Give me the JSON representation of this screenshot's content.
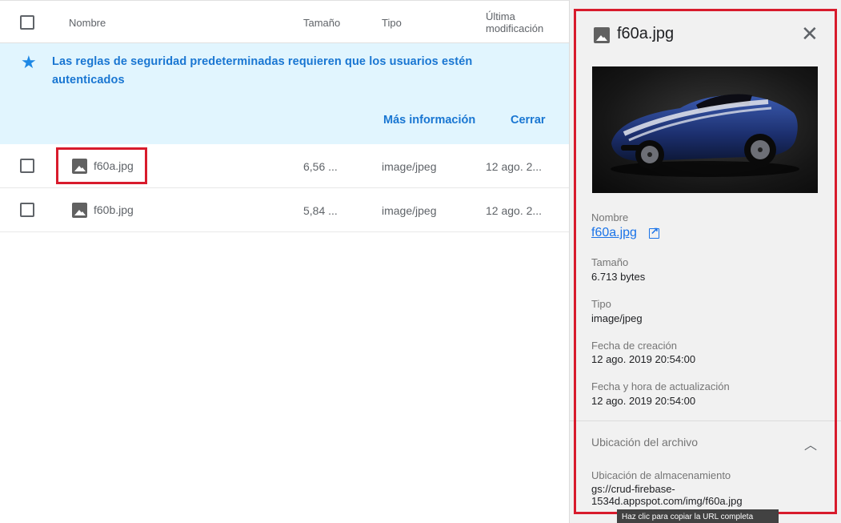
{
  "list": {
    "headers": {
      "name": "Nombre",
      "size": "Tamaño",
      "type": "Tipo",
      "modified_line1": "Última",
      "modified_line2": "modificación"
    },
    "banner": {
      "message": "Las reglas de seguridad predeterminadas requieren que los usuarios estén autenticados",
      "more_info": "Más información",
      "close": "Cerrar",
      "icon": "star-icon",
      "accent": "#1976d2",
      "background": "#e1f5fe"
    },
    "rows": [
      {
        "name": "f60a.jpg",
        "size": "6,56 ...",
        "type": "image/jpeg",
        "modified": "12 ago. 2...",
        "icon": "image-icon"
      },
      {
        "name": "f60b.jpg",
        "size": "5,84 ...",
        "type": "image/jpeg",
        "modified": "12 ago. 2...",
        "icon": "image-icon"
      }
    ],
    "highlight_color": "#d81b2c"
  },
  "detail": {
    "title": "f60a.jpg",
    "title_icon": "image-icon",
    "close_icon": "close-icon",
    "name_label": "Nombre",
    "name_value": "f60a.jpg",
    "size_label": "Tamaño",
    "size_value": "6.713 bytes",
    "type_label": "Tipo",
    "type_value": "image/jpeg",
    "created_label": "Fecha de creación",
    "created_value": "12 ago. 2019 20:54:00",
    "updated_label": "Fecha y hora de actualización",
    "updated_value": "12 ago. 2019 20:54:00",
    "location_section": "Ubicación del archivo",
    "storage_label": "Ubicación de almacenamiento",
    "storage_value_line1": "gs://crud-firebase-",
    "storage_value_line2": "1534d.appspot.com/img/f60a.jpg",
    "tooltip": "Haz clic para copiar la URL completa"
  }
}
